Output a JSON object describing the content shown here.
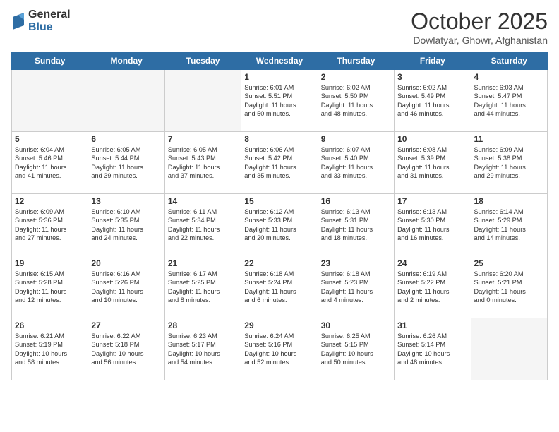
{
  "logo": {
    "general": "General",
    "blue": "Blue"
  },
  "header": {
    "month": "October 2025",
    "location": "Dowlatyar, Ghowr, Afghanistan"
  },
  "days_of_week": [
    "Sunday",
    "Monday",
    "Tuesday",
    "Wednesday",
    "Thursday",
    "Friday",
    "Saturday"
  ],
  "weeks": [
    [
      {
        "day": "",
        "info": ""
      },
      {
        "day": "",
        "info": ""
      },
      {
        "day": "",
        "info": ""
      },
      {
        "day": "1",
        "info": "Sunrise: 6:01 AM\nSunset: 5:51 PM\nDaylight: 11 hours\nand 50 minutes."
      },
      {
        "day": "2",
        "info": "Sunrise: 6:02 AM\nSunset: 5:50 PM\nDaylight: 11 hours\nand 48 minutes."
      },
      {
        "day": "3",
        "info": "Sunrise: 6:02 AM\nSunset: 5:49 PM\nDaylight: 11 hours\nand 46 minutes."
      },
      {
        "day": "4",
        "info": "Sunrise: 6:03 AM\nSunset: 5:47 PM\nDaylight: 11 hours\nand 44 minutes."
      }
    ],
    [
      {
        "day": "5",
        "info": "Sunrise: 6:04 AM\nSunset: 5:46 PM\nDaylight: 11 hours\nand 41 minutes."
      },
      {
        "day": "6",
        "info": "Sunrise: 6:05 AM\nSunset: 5:44 PM\nDaylight: 11 hours\nand 39 minutes."
      },
      {
        "day": "7",
        "info": "Sunrise: 6:05 AM\nSunset: 5:43 PM\nDaylight: 11 hours\nand 37 minutes."
      },
      {
        "day": "8",
        "info": "Sunrise: 6:06 AM\nSunset: 5:42 PM\nDaylight: 11 hours\nand 35 minutes."
      },
      {
        "day": "9",
        "info": "Sunrise: 6:07 AM\nSunset: 5:40 PM\nDaylight: 11 hours\nand 33 minutes."
      },
      {
        "day": "10",
        "info": "Sunrise: 6:08 AM\nSunset: 5:39 PM\nDaylight: 11 hours\nand 31 minutes."
      },
      {
        "day": "11",
        "info": "Sunrise: 6:09 AM\nSunset: 5:38 PM\nDaylight: 11 hours\nand 29 minutes."
      }
    ],
    [
      {
        "day": "12",
        "info": "Sunrise: 6:09 AM\nSunset: 5:36 PM\nDaylight: 11 hours\nand 27 minutes."
      },
      {
        "day": "13",
        "info": "Sunrise: 6:10 AM\nSunset: 5:35 PM\nDaylight: 11 hours\nand 24 minutes."
      },
      {
        "day": "14",
        "info": "Sunrise: 6:11 AM\nSunset: 5:34 PM\nDaylight: 11 hours\nand 22 minutes."
      },
      {
        "day": "15",
        "info": "Sunrise: 6:12 AM\nSunset: 5:33 PM\nDaylight: 11 hours\nand 20 minutes."
      },
      {
        "day": "16",
        "info": "Sunrise: 6:13 AM\nSunset: 5:31 PM\nDaylight: 11 hours\nand 18 minutes."
      },
      {
        "day": "17",
        "info": "Sunrise: 6:13 AM\nSunset: 5:30 PM\nDaylight: 11 hours\nand 16 minutes."
      },
      {
        "day": "18",
        "info": "Sunrise: 6:14 AM\nSunset: 5:29 PM\nDaylight: 11 hours\nand 14 minutes."
      }
    ],
    [
      {
        "day": "19",
        "info": "Sunrise: 6:15 AM\nSunset: 5:28 PM\nDaylight: 11 hours\nand 12 minutes."
      },
      {
        "day": "20",
        "info": "Sunrise: 6:16 AM\nSunset: 5:26 PM\nDaylight: 11 hours\nand 10 minutes."
      },
      {
        "day": "21",
        "info": "Sunrise: 6:17 AM\nSunset: 5:25 PM\nDaylight: 11 hours\nand 8 minutes."
      },
      {
        "day": "22",
        "info": "Sunrise: 6:18 AM\nSunset: 5:24 PM\nDaylight: 11 hours\nand 6 minutes."
      },
      {
        "day": "23",
        "info": "Sunrise: 6:18 AM\nSunset: 5:23 PM\nDaylight: 11 hours\nand 4 minutes."
      },
      {
        "day": "24",
        "info": "Sunrise: 6:19 AM\nSunset: 5:22 PM\nDaylight: 11 hours\nand 2 minutes."
      },
      {
        "day": "25",
        "info": "Sunrise: 6:20 AM\nSunset: 5:21 PM\nDaylight: 11 hours\nand 0 minutes."
      }
    ],
    [
      {
        "day": "26",
        "info": "Sunrise: 6:21 AM\nSunset: 5:19 PM\nDaylight: 10 hours\nand 58 minutes."
      },
      {
        "day": "27",
        "info": "Sunrise: 6:22 AM\nSunset: 5:18 PM\nDaylight: 10 hours\nand 56 minutes."
      },
      {
        "day": "28",
        "info": "Sunrise: 6:23 AM\nSunset: 5:17 PM\nDaylight: 10 hours\nand 54 minutes."
      },
      {
        "day": "29",
        "info": "Sunrise: 6:24 AM\nSunset: 5:16 PM\nDaylight: 10 hours\nand 52 minutes."
      },
      {
        "day": "30",
        "info": "Sunrise: 6:25 AM\nSunset: 5:15 PM\nDaylight: 10 hours\nand 50 minutes."
      },
      {
        "day": "31",
        "info": "Sunrise: 6:26 AM\nSunset: 5:14 PM\nDaylight: 10 hours\nand 48 minutes."
      },
      {
        "day": "",
        "info": ""
      }
    ]
  ]
}
